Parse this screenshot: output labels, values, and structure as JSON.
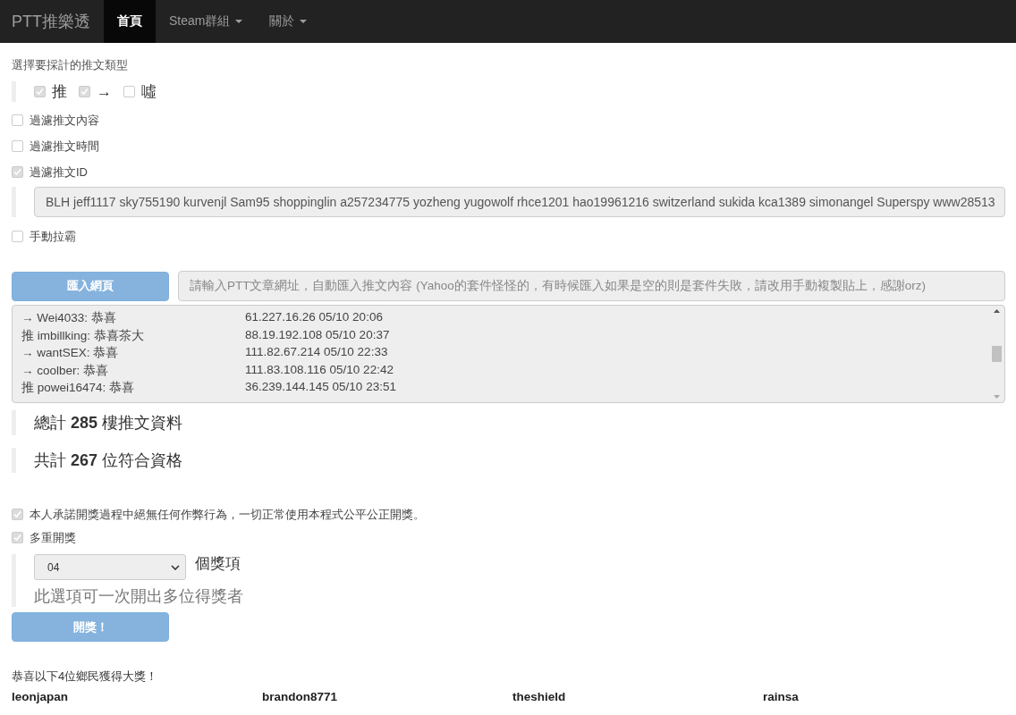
{
  "navbar": {
    "brand": "PTT推樂透",
    "items": [
      {
        "label": "首頁",
        "selected": true,
        "dropdown": false
      },
      {
        "label": "Steam群組",
        "selected": false,
        "dropdown": true
      },
      {
        "label": "關於",
        "selected": false,
        "dropdown": true
      }
    ]
  },
  "type_label": "選擇要採計的推文類型",
  "types": [
    {
      "label": "推",
      "checked": true
    },
    {
      "label": "→",
      "checked": true
    },
    {
      "label": "噓",
      "checked": false
    }
  ],
  "filters": [
    {
      "label": "過濾推文內容",
      "checked": false
    },
    {
      "label": "過濾推文時間",
      "checked": false
    },
    {
      "label": "過濾推文ID",
      "checked": true
    }
  ],
  "id_filter": {
    "value": "BLH jeff1117 sky755190 kurvenjl Sam95 shoppinglin a257234775 yozheng yugowolf rhce1201 hao19961216 switzerland sukida kca1389 simonangel Superspy www28513"
  },
  "manual": {
    "label": "手動拉霸",
    "checked": false
  },
  "import_button": "匯入網頁",
  "url_field": {
    "placeholder": "請輸入PTT文章網址，自動匯入推文內容 (Yahoo的套件怪怪的，有時候匯入如果是空的則是套件失敗，請改用手動複製貼上，感謝orz)"
  },
  "comments": [
    {
      "text": "→ Wei4033: 恭喜",
      "info": "61.227.16.26 05/10 20:06"
    },
    {
      "text": "推 imbillking: 恭喜茶大",
      "info": "88.19.192.108 05/10 20:37"
    },
    {
      "text": "→ wantSEX: 恭喜",
      "info": "111.82.67.214 05/10 22:33"
    },
    {
      "text": "→ coolber: 恭喜",
      "info": "111.83.108.116 05/10 22:42"
    },
    {
      "text": "推 powei16474: 恭喜",
      "info": "36.239.144.145 05/10 23:51"
    }
  ],
  "stats": [
    "總計 **285** 樓推文資料",
    "共計 **267** 位符合資格"
  ],
  "pledge": {
    "label": "本人承諾開獎過程中絕無任何作弊行為，一切正常使用本程式公平公正開獎。",
    "checked": true
  },
  "multi": {
    "label": "多重開獎",
    "checked": true
  },
  "prize_count": {
    "value": "04",
    "suffix": "個獎項",
    "hint": "此選項可一次開出多位得獎者"
  },
  "draw_button": "開獎！",
  "result_label": "恭喜以下4位鄉民獲得大獎！",
  "winners": [
    "leonjapan",
    "brandon8771",
    "theshield",
    "rainsa"
  ]
}
